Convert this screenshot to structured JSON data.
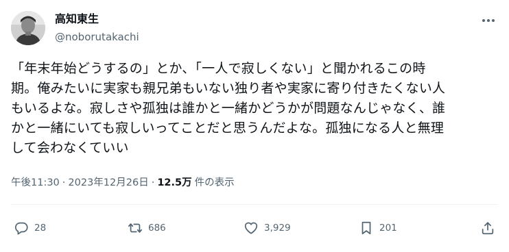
{
  "author": {
    "display_name": "高知東生",
    "handle": "@noborutakachi"
  },
  "tweet": {
    "text": "「年末年始どうするの」とか、「一人で寂しくない」と聞かれるこの時\n期。俺みたいに実家も親兄弟もいない独り者や実家に寄り付きたくない人\nもいるよな。寂しさや孤独は誰かと一緒かどうかが問題なんじゃなく、誰\nかと一緒にいても寂しいってことだと思うんだよな。孤独になる人と無理\nして会わなくていい"
  },
  "meta": {
    "time": "午後11:30",
    "separator": "·",
    "date": "2023年12月26日",
    "views_count": "12.5万",
    "views_label": "件の表示"
  },
  "actions": {
    "reply_count": "28",
    "retweet_count": "686",
    "like_count": "3,929",
    "bookmark_count": "201"
  },
  "icons": {
    "more": "more-dots-icon",
    "reply": "reply-bubble-icon",
    "retweet": "retweet-arrows-icon",
    "like": "heart-icon",
    "bookmark": "bookmark-icon",
    "share": "share-upload-icon"
  },
  "colors": {
    "text": "#0f1419",
    "secondary": "#536471",
    "divider": "#eff3f4",
    "background": "#ffffff"
  }
}
